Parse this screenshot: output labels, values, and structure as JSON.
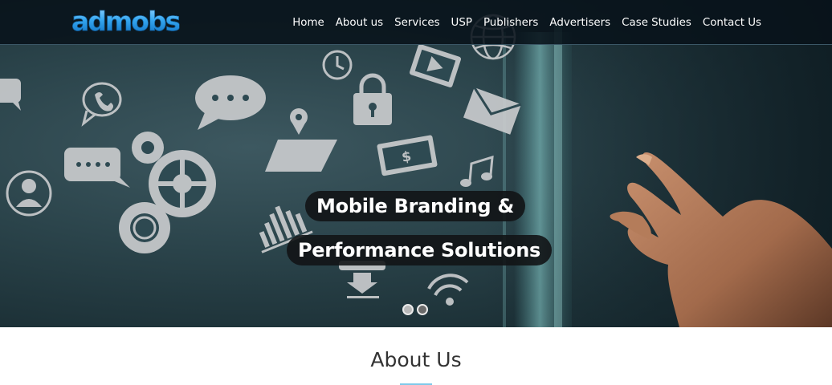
{
  "brand": {
    "logo_text": "admobs",
    "logo_color": "#2d9be6"
  },
  "nav": {
    "items": [
      {
        "label": "Home"
      },
      {
        "label": "About us"
      },
      {
        "label": "Services"
      },
      {
        "label": "USP"
      },
      {
        "label": "Publishers"
      },
      {
        "label": "Advertisers"
      },
      {
        "label": "Case Studies"
      },
      {
        "label": "Contact Us"
      }
    ]
  },
  "hero": {
    "headline_line1": "Mobile Branding &",
    "headline_line2": "Performance Solutions",
    "slides": {
      "count": 2,
      "active": 0
    },
    "icons": [
      "chat-bubble-icon",
      "phone-bubble-icon",
      "speech-bubble-icon",
      "gears-icon",
      "user-icon",
      "map-pin-icon",
      "clock-icon",
      "lock-icon",
      "video-icon",
      "globe-icon",
      "envelope-icon",
      "dollar-icon",
      "music-note-icon",
      "bar-chart-icon",
      "download-cloud-icon",
      "wifi-icon",
      "hand-icon"
    ],
    "accent_color": "#2b444b"
  },
  "about": {
    "title": "About Us",
    "accent_color": "#7ec9ea"
  }
}
